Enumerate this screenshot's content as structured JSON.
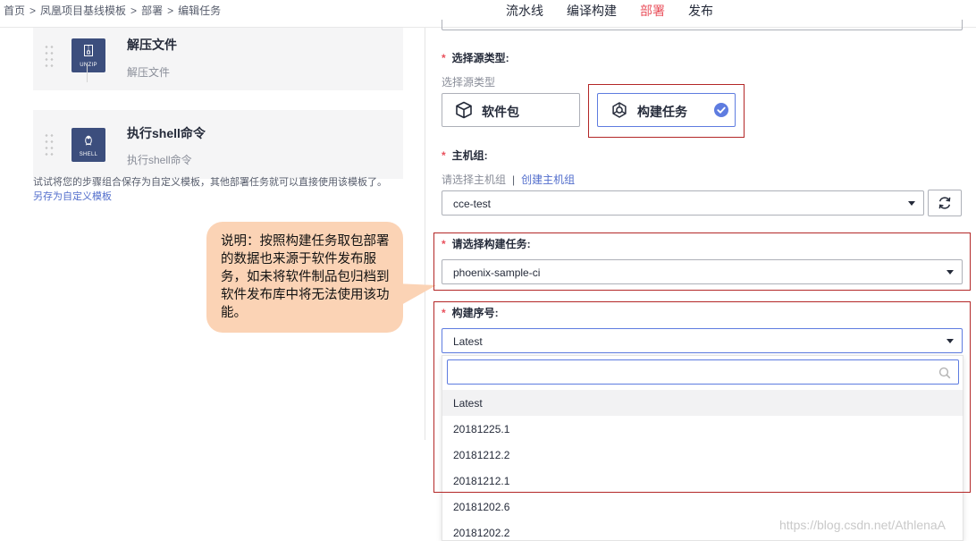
{
  "breadcrumb": {
    "items": [
      "首页",
      "凤凰项目基线模板",
      "部署",
      "编辑任务"
    ],
    "separator": ">"
  },
  "topnav": {
    "tabs": [
      "流水线",
      "编译构建",
      "部署",
      "发布"
    ],
    "active": "部署",
    "active_color": "#e9505c"
  },
  "steps": [
    {
      "title": "解压文件",
      "subtitle": "解压文件",
      "icon_caption": "UNZIP",
      "icon": "zip-file-icon"
    },
    {
      "title": "执行shell命令",
      "subtitle": "执行shell命令",
      "icon_caption": "SHELL",
      "icon": "linux-penguin-icon"
    }
  ],
  "template_tip": {
    "text": "试试将您的步骤组合保存为自定义模板，其他部署任务就可以直接使用该模板了。",
    "link": "另存为自定义模板"
  },
  "callout": {
    "text": "说明：按照构建任务取包部署的数据也来源于软件发布服务，如未将软件制品包归档到软件发布库中将无法使用该功能。",
    "color": "#fbd3b5"
  },
  "source_type": {
    "required_mark": "*",
    "label": "选择源类型:",
    "hint": "选择源类型",
    "options": [
      {
        "label": "软件包",
        "icon": "package-cube-icon",
        "selected": false
      },
      {
        "label": "构建任务",
        "icon": "build-gear-icon",
        "selected": true
      }
    ]
  },
  "host_group": {
    "required_mark": "*",
    "label": "主机组:",
    "hint": "请选择主机组",
    "separator": "|",
    "create_link": "创建主机组",
    "value": "cce-test"
  },
  "build_task": {
    "required_mark": "*",
    "label": "请选择构建任务:",
    "value": "phoenix-sample-ci"
  },
  "build_number": {
    "required_mark": "*",
    "label": "构建序号:",
    "value": "Latest",
    "search_placeholder": "",
    "options": [
      "Latest",
      "20181225.1",
      "20181212.2",
      "20181212.1",
      "20181202.6",
      "20181202.2"
    ],
    "hovered": "Latest"
  },
  "colors": {
    "accent": "#5e7ce0",
    "highlight_box": "#b32727",
    "required": "#e9505c",
    "link": "#526ecc"
  },
  "watermark": "https://blog.csdn.net/AthlenaA"
}
